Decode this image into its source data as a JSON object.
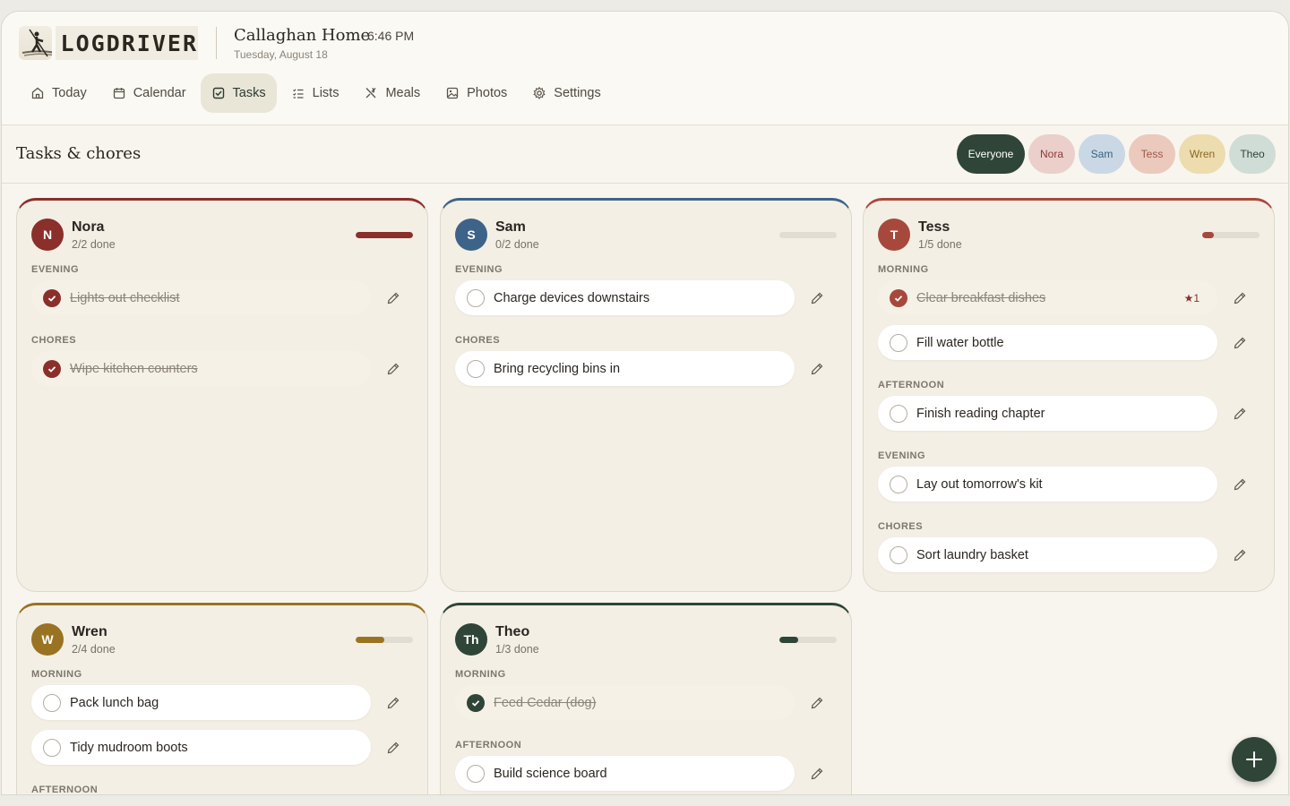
{
  "app": {
    "brand": "LOGDRIVER",
    "home_name": "Callaghan Home",
    "time": "6:46 PM",
    "date": "Tuesday, August 18"
  },
  "nav": [
    {
      "label": "Today",
      "icon": "home-icon",
      "active": false
    },
    {
      "label": "Calendar",
      "icon": "calendar-icon",
      "active": false
    },
    {
      "label": "Tasks",
      "icon": "check-square-icon",
      "active": true
    },
    {
      "label": "Lists",
      "icon": "list-icon",
      "active": false
    },
    {
      "label": "Meals",
      "icon": "utensils-icon",
      "active": false
    },
    {
      "label": "Photos",
      "icon": "image-icon",
      "active": false
    },
    {
      "label": "Settings",
      "icon": "gear-icon",
      "active": false
    }
  ],
  "page": {
    "title": "Tasks & chores"
  },
  "filters": [
    "Everyone",
    "Nora",
    "Sam",
    "Tess",
    "Wren",
    "Theo"
  ],
  "people": [
    {
      "initial": "N",
      "name": "Nora",
      "done_text": "2/2 done",
      "progress": 1.0,
      "color": "#8b2f2b",
      "sections": [
        {
          "label": "EVENING",
          "tasks": [
            {
              "text": "Lights out checklist",
              "done": true
            }
          ]
        },
        {
          "label": "CHORES",
          "tasks": [
            {
              "text": "Wipe kitchen counters",
              "done": true
            }
          ]
        }
      ]
    },
    {
      "initial": "S",
      "name": "Sam",
      "done_text": "0/2 done",
      "progress": 0.0,
      "color": "#3e6388",
      "sections": [
        {
          "label": "EVENING",
          "tasks": [
            {
              "text": "Charge devices downstairs",
              "done": false
            }
          ]
        },
        {
          "label": "CHORES",
          "tasks": [
            {
              "text": "Bring recycling bins in",
              "done": false
            }
          ]
        }
      ]
    },
    {
      "initial": "T",
      "name": "Tess",
      "done_text": "1/5 done",
      "progress": 0.2,
      "color": "#a6493c",
      "sections": [
        {
          "label": "MORNING",
          "tasks": [
            {
              "text": "Clear breakfast dishes",
              "done": true,
              "star": "★1"
            },
            {
              "text": "Fill water bottle",
              "done": false
            }
          ]
        },
        {
          "label": "AFTERNOON",
          "tasks": [
            {
              "text": "Finish reading chapter",
              "done": false
            }
          ]
        },
        {
          "label": "EVENING",
          "tasks": [
            {
              "text": "Lay out tomorrow's kit",
              "done": false
            }
          ]
        },
        {
          "label": "CHORES",
          "tasks": [
            {
              "text": "Sort laundry basket",
              "done": false
            }
          ]
        }
      ]
    },
    {
      "initial": "W",
      "name": "Wren",
      "done_text": "2/4 done",
      "progress": 0.5,
      "color": "#9a7322",
      "sections": [
        {
          "label": "MORNING",
          "tasks": [
            {
              "text": "Pack lunch bag",
              "done": false
            },
            {
              "text": "Tidy mudroom boots",
              "done": false
            }
          ]
        },
        {
          "label": "AFTERNOON",
          "tasks": []
        }
      ]
    },
    {
      "initial": "Th",
      "name": "Theo",
      "done_text": "1/3 done",
      "progress": 0.33,
      "color": "#2e4537",
      "sections": [
        {
          "label": "MORNING",
          "tasks": [
            {
              "text": "Feed Cedar (dog)",
              "done": true
            }
          ]
        },
        {
          "label": "AFTERNOON",
          "tasks": [
            {
              "text": "Build science board",
              "done": false
            }
          ]
        }
      ]
    }
  ]
}
